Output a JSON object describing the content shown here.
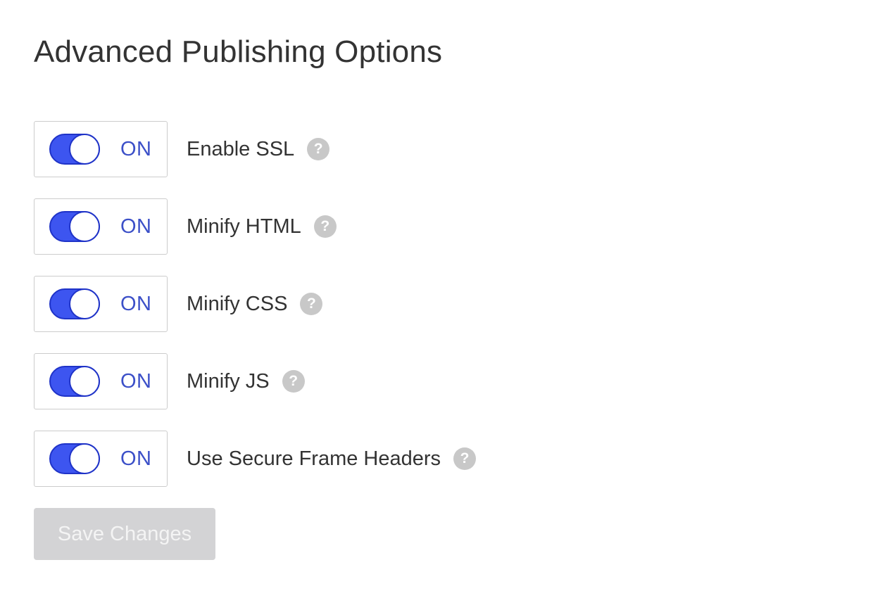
{
  "page": {
    "title": "Advanced Publishing Options"
  },
  "options": [
    {
      "label": "Enable SSL",
      "state_label": "ON",
      "enabled": true,
      "help_icon": "question-circle-icon"
    },
    {
      "label": "Minify HTML",
      "state_label": "ON",
      "enabled": true,
      "help_icon": "question-circle-icon"
    },
    {
      "label": "Minify CSS",
      "state_label": "ON",
      "enabled": true,
      "help_icon": "question-circle-icon"
    },
    {
      "label": "Minify JS",
      "state_label": "ON",
      "enabled": true,
      "help_icon": "question-circle-icon"
    },
    {
      "label": "Use Secure Frame Headers",
      "state_label": "ON",
      "enabled": true,
      "help_icon": "question-circle-icon"
    }
  ],
  "help_glyph": "?",
  "actions": {
    "save_label": "Save Changes",
    "save_disabled": true
  },
  "colors": {
    "toggle_on": "#3d55f0",
    "toggle_border": "#1f33c8",
    "state_text": "#3c50c8",
    "help_icon_bg": "#c8c8c8",
    "save_disabled_bg": "#d3d3d5"
  }
}
